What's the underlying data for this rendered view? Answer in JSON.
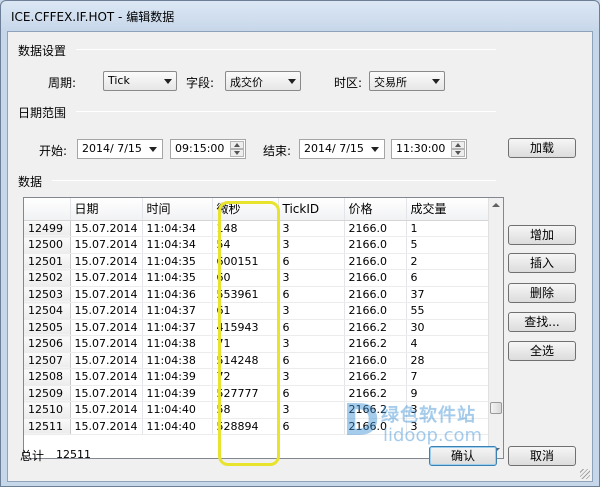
{
  "window": {
    "title": "ICE.CFFEX.IF.HOT - 编辑数据"
  },
  "data_settings": {
    "section_label": "数据设置",
    "period_label": "周期:",
    "period_value": "Tick",
    "field_label": "字段:",
    "field_value": "成交价",
    "timezone_label": "时区:",
    "timezone_value": "交易所"
  },
  "date_range": {
    "section_label": "日期范围",
    "start_label": "开始:",
    "start_date": "2014/ 7/15",
    "start_time": "09:15:00",
    "end_label": "结束:",
    "end_date": "2014/ 7/15",
    "end_time": "11:30:00",
    "load_button": "加载"
  },
  "data_section": {
    "section_label": "数据",
    "columns": [
      "",
      "日期",
      "时间",
      "微秒",
      "TickID",
      "价格",
      "成交量"
    ],
    "rows": [
      [
        "12499",
        "15.07.2014",
        "11:04:34",
        "148",
        "3",
        "2166.0",
        "1"
      ],
      [
        "12500",
        "15.07.2014",
        "11:04:34",
        "54",
        "3",
        "2166.0",
        "5"
      ],
      [
        "12501",
        "15.07.2014",
        "11:04:35",
        "600151",
        "6",
        "2166.0",
        "2"
      ],
      [
        "12502",
        "15.07.2014",
        "11:04:35",
        "60",
        "3",
        "2166.0",
        "6"
      ],
      [
        "12503",
        "15.07.2014",
        "11:04:36",
        "553961",
        "6",
        "2166.0",
        "37"
      ],
      [
        "12504",
        "15.07.2014",
        "11:04:37",
        "61",
        "3",
        "2166.0",
        "55"
      ],
      [
        "12505",
        "15.07.2014",
        "11:04:37",
        "415943",
        "6",
        "2166.2",
        "30"
      ],
      [
        "12506",
        "15.07.2014",
        "11:04:38",
        "71",
        "3",
        "2166.2",
        "4"
      ],
      [
        "12507",
        "15.07.2014",
        "11:04:38",
        "514248",
        "6",
        "2166.0",
        "28"
      ],
      [
        "12508",
        "15.07.2014",
        "11:04:39",
        "72",
        "3",
        "2166.2",
        "7"
      ],
      [
        "12509",
        "15.07.2014",
        "11:04:39",
        "527777",
        "6",
        "2166.2",
        "9"
      ],
      [
        "12510",
        "15.07.2014",
        "11:04:40",
        "58",
        "3",
        "2166.2",
        "3"
      ],
      [
        "12511",
        "15.07.2014",
        "11:04:40",
        "528894",
        "6",
        "2166.0",
        "3"
      ]
    ]
  },
  "side_buttons": {
    "add": "增加",
    "insert": "插入",
    "delete": "删除",
    "find": "查找...",
    "select_all": "全选"
  },
  "footer": {
    "total_label": "总计",
    "total_value": "12511",
    "ok_button": "确认",
    "cancel_button": "取消"
  },
  "watermark": {
    "cn": "绿色软件站",
    "en": "lidoop.com"
  },
  "colors": {
    "highlight": "#e8e32c",
    "watermark": "#3b8fd6"
  }
}
